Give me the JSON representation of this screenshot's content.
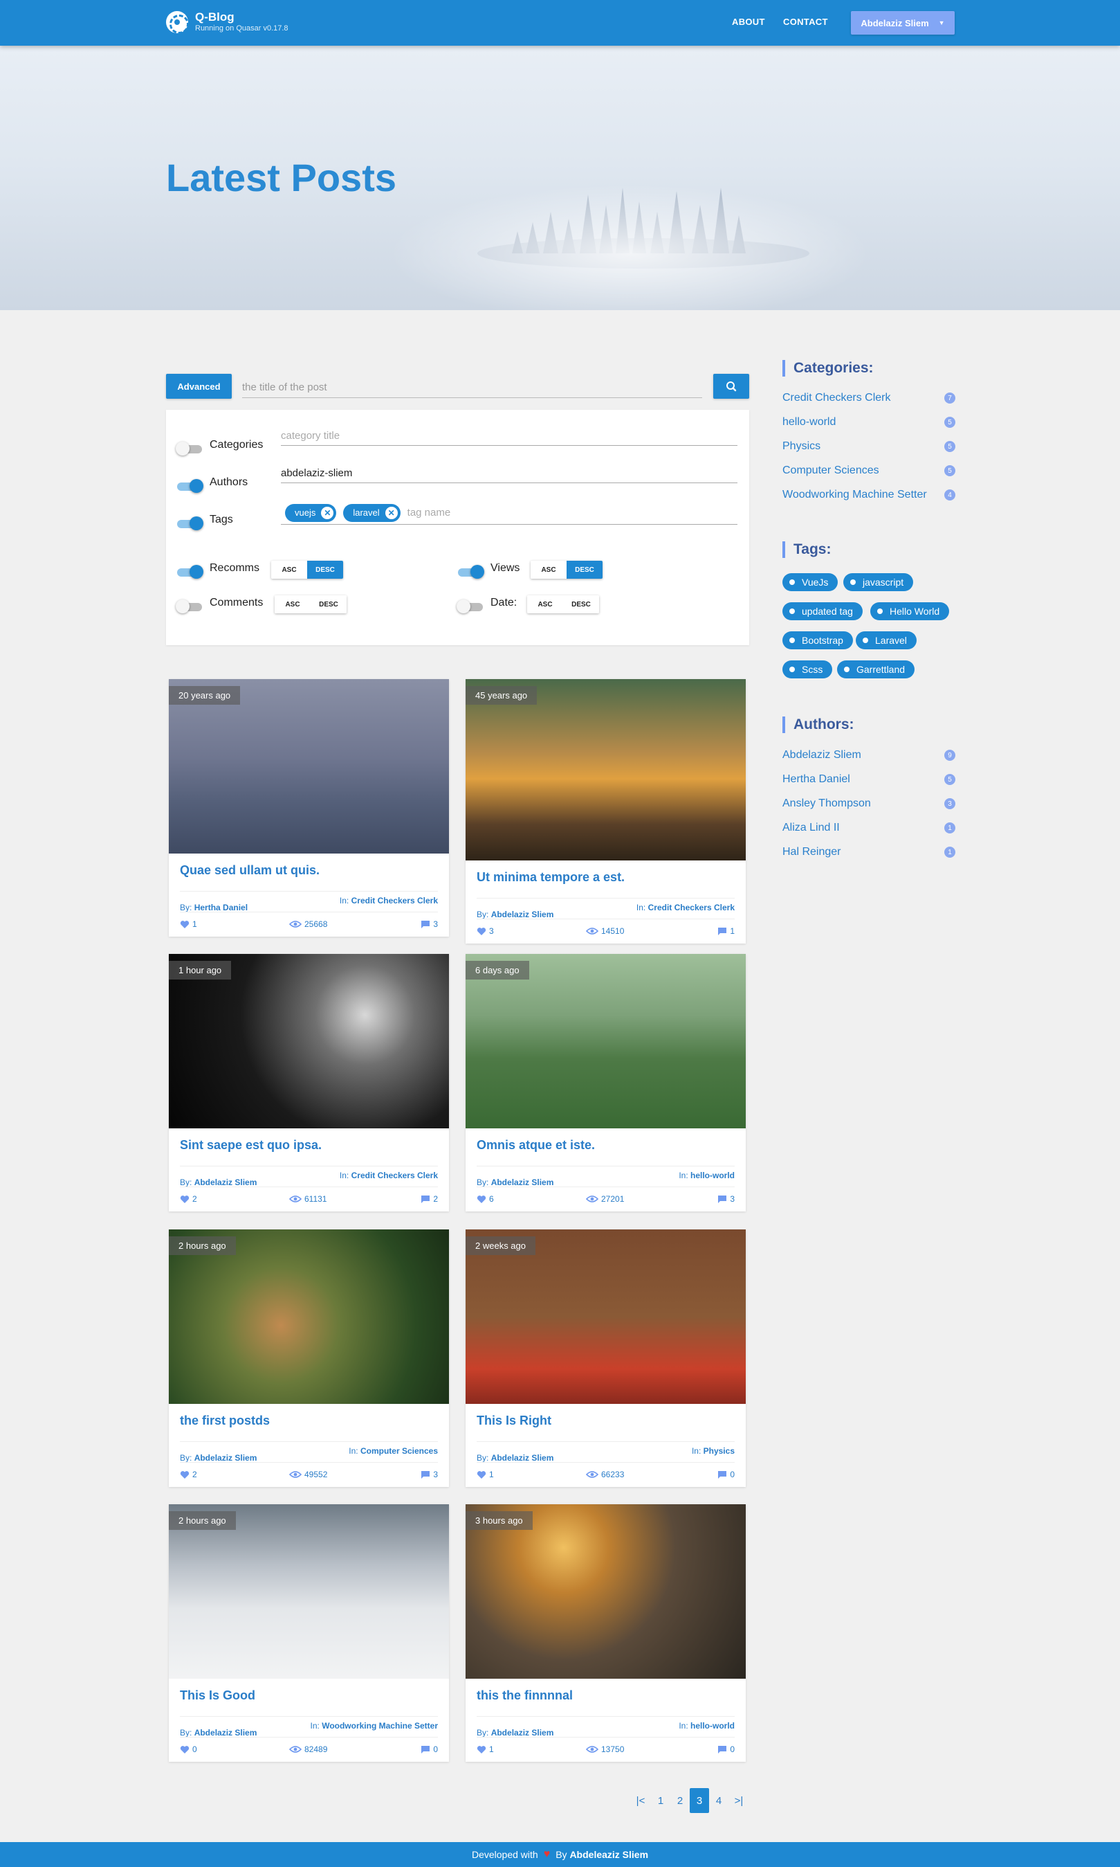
{
  "header": {
    "brand_title": "Q-Blog",
    "brand_subtitle": "Running on Quasar v0.17.8",
    "nav": [
      "ABOUT",
      "CONTACT"
    ],
    "user_name": "Abdelaziz Sliem",
    "accent": "#1e88d2"
  },
  "hero": {
    "title": "Latest Posts"
  },
  "search": {
    "advanced_label": "Advanced",
    "placeholder": "the title of the post",
    "icon": "search-icon"
  },
  "filters": {
    "categories": {
      "label": "Categories",
      "enabled": false,
      "placeholder": "category title",
      "value": ""
    },
    "authors": {
      "label": "Authors",
      "enabled": true,
      "value": "abdelaziz-sliem"
    },
    "tags": {
      "label": "Tags",
      "enabled": true,
      "chips": [
        "vuejs",
        "laravel"
      ],
      "placeholder": "tag name"
    },
    "sorts": [
      {
        "label": "Recomms",
        "enabled": true,
        "asc": "ASC",
        "desc": "DESC",
        "selected": "DESC"
      },
      {
        "label": "Views",
        "enabled": true,
        "asc": "ASC",
        "desc": "DESC",
        "selected": "DESC"
      },
      {
        "label": "Comments",
        "enabled": false,
        "asc": "ASC",
        "desc": "DESC",
        "selected": ""
      },
      {
        "label": "Date:",
        "enabled": false,
        "asc": "ASC",
        "desc": "DESC",
        "selected": ""
      }
    ]
  },
  "posts": [
    {
      "age": "20 years ago",
      "title": "Quae sed ullam ut quis.",
      "by_label": "By:",
      "author": "Hertha Daniel",
      "in_label": "In:",
      "category": "Credit Checkers Clerk",
      "likes": "1",
      "views": "25668",
      "comments": "3"
    },
    {
      "age": "45 years ago",
      "title": "Ut minima tempore a est.",
      "by_label": "By:",
      "author": "Abdelaziz Sliem",
      "in_label": "In:",
      "category": "Credit Checkers Clerk",
      "likes": "3",
      "views": "14510",
      "comments": "1"
    },
    {
      "age": "1 hour ago",
      "title": "Sint saepe est quo ipsa.",
      "by_label": "By:",
      "author": "Abdelaziz Sliem",
      "in_label": "In:",
      "category": "Credit Checkers Clerk",
      "likes": "2",
      "views": "61131",
      "comments": "2"
    },
    {
      "age": "6 days ago",
      "title": "Omnis atque et iste.",
      "by_label": "By:",
      "author": "Abdelaziz Sliem",
      "in_label": "In:",
      "category": "hello-world",
      "likes": "6",
      "views": "27201",
      "comments": "3"
    },
    {
      "age": "2 hours ago",
      "title": "the first postds",
      "by_label": "By:",
      "author": "Abdelaziz Sliem",
      "in_label": "In:",
      "category": "Computer Sciences",
      "likes": "2",
      "views": "49552",
      "comments": "3"
    },
    {
      "age": "2 weeks ago",
      "title": "This Is Right",
      "by_label": "By:",
      "author": "Abdelaziz Sliem",
      "in_label": "In:",
      "category": "Physics",
      "likes": "1",
      "views": "66233",
      "comments": "0"
    },
    {
      "age": "2 hours ago",
      "title": "This Is Good",
      "by_label": "By:",
      "author": "Abdelaziz Sliem",
      "in_label": "In:",
      "category": "Woodworking Machine Setter",
      "likes": "0",
      "views": "82489",
      "comments": "0"
    },
    {
      "age": "3 hours ago",
      "title": "this the finnnnal",
      "by_label": "By:",
      "author": "Abdelaziz Sliem",
      "in_label": "In:",
      "category": "hello-world",
      "likes": "1",
      "views": "13750",
      "comments": "0"
    }
  ],
  "pagination": {
    "first": "|<",
    "pages": [
      "1",
      "2",
      "3",
      "4"
    ],
    "current": "3",
    "last": ">|"
  },
  "sidebar": {
    "categories_title": "Categories:",
    "categories": [
      {
        "name": "Credit Checkers Clerk",
        "count": "7"
      },
      {
        "name": "hello-world",
        "count": "5"
      },
      {
        "name": "Physics",
        "count": "5"
      },
      {
        "name": "Computer Sciences",
        "count": "5"
      },
      {
        "name": "Woodworking Machine Setter",
        "count": "4"
      }
    ],
    "tags_title": "Tags:",
    "tags": [
      "VueJs",
      "javascript",
      "updated tag",
      "Hello World",
      "Bootstrap",
      "Laravel",
      "Scss",
      "Garrettland"
    ],
    "authors_title": "Authors:",
    "authors": [
      {
        "name": "Abdelaziz Sliem",
        "count": "9"
      },
      {
        "name": "Hertha Daniel",
        "count": "5"
      },
      {
        "name": "Ansley Thompson",
        "count": "3"
      },
      {
        "name": "Aliza Lind II",
        "count": "1"
      },
      {
        "name": "Hal Reinger",
        "count": "1"
      }
    ]
  },
  "footer": {
    "prefix": "Developed with",
    "by": "By",
    "author": "Abdeleaziz Sliem"
  }
}
